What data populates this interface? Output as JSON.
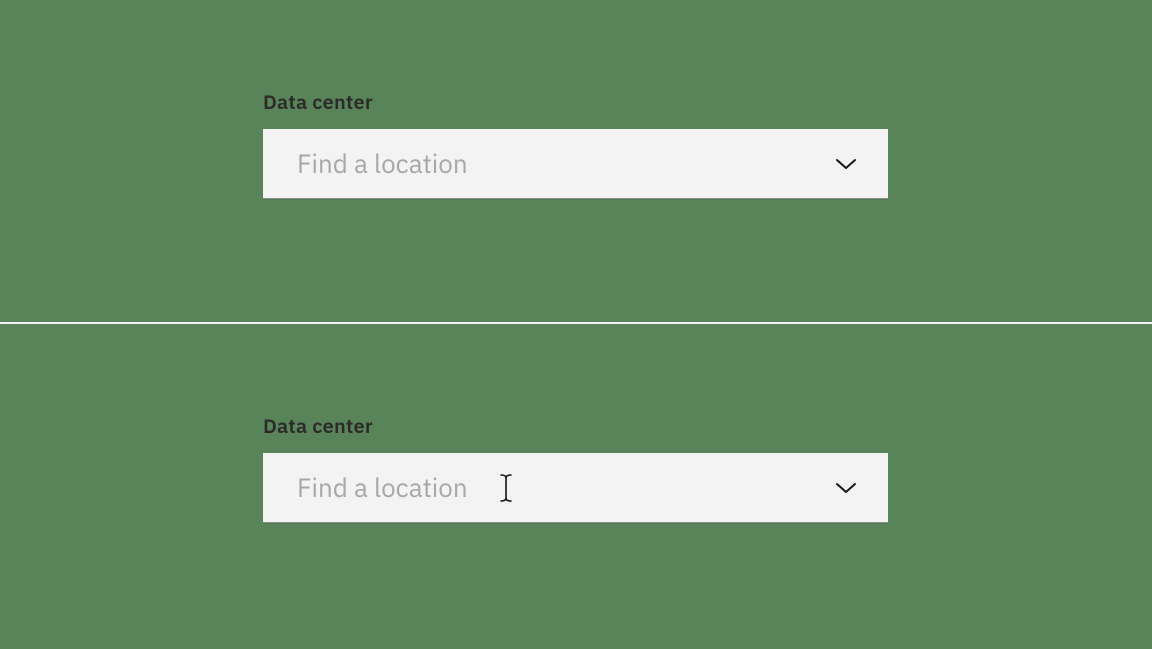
{
  "top": {
    "label": "Data center",
    "placeholder": "Find a location",
    "value": ""
  },
  "bottom": {
    "label": "Data center",
    "placeholder": "Find a location",
    "value": ""
  }
}
